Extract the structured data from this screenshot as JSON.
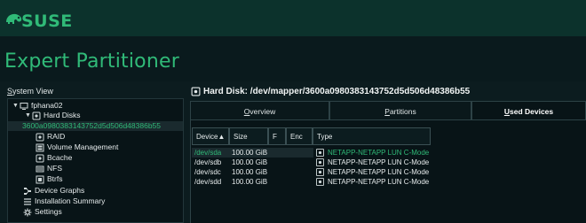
{
  "brand": {
    "logo_text": "SUSE",
    "green": "#30ba78",
    "banner_bg": "#0c322c"
  },
  "app": {
    "title": "Expert Partitioner"
  },
  "system_view": {
    "label": "System View",
    "tree": [
      {
        "label": "fphana02",
        "icon": "computer-icon",
        "toggle": "▼"
      },
      {
        "label": "Hard Disks",
        "icon": "harddisk-icon",
        "toggle": "▼"
      },
      {
        "label": "3600a0980383143752d5d506d48386b55",
        "icon": "",
        "selected": true
      },
      {
        "label": "RAID",
        "icon": "raid-icon"
      },
      {
        "label": "Volume Management",
        "icon": "volume-icon"
      },
      {
        "label": "Bcache",
        "icon": "bcache-icon"
      },
      {
        "label": "NFS",
        "icon": "nfs-icon"
      },
      {
        "label": "Btrfs",
        "icon": "btrfs-icon"
      },
      {
        "label": "Device Graphs",
        "icon": "graph-icon"
      },
      {
        "label": "Installation Summary",
        "icon": "summary-icon"
      },
      {
        "label": "Settings",
        "icon": "gear-icon"
      }
    ]
  },
  "detail": {
    "heading": "Hard Disk: /dev/mapper/3600a0980383143752d5d506d48386b55",
    "tabs": [
      {
        "label": "Overview",
        "active": false
      },
      {
        "label": "Partitions",
        "active": false
      },
      {
        "label": "Used Devices",
        "active": true
      }
    ],
    "table": {
      "columns": [
        "Device▲",
        "Size",
        "F",
        "Enc",
        "Type"
      ],
      "rows": [
        [
          "/dev/sda",
          "100.00 GiB",
          "",
          "",
          "NETAPP-NETAPP LUN C-Mode"
        ],
        [
          "/dev/sdb",
          "100.00 GiB",
          "",
          "",
          "NETAPP-NETAPP LUN C-Mode"
        ],
        [
          "/dev/sdc",
          "100.00 GiB",
          "",
          "",
          "NETAPP-NETAPP LUN C-Mode"
        ],
        [
          "/dev/sdd",
          "100.00 GiB",
          "",
          "",
          "NETAPP-NETAPP LUN C-Mode"
        ]
      ]
    }
  }
}
